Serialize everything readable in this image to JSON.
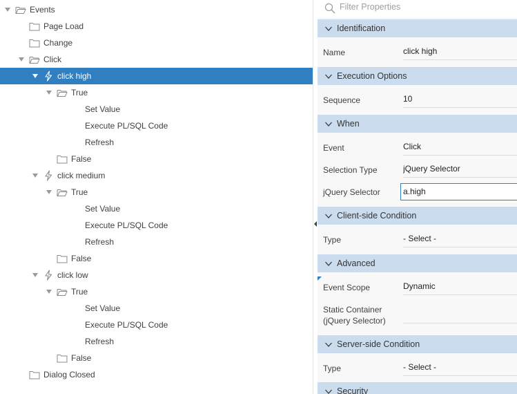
{
  "tree": {
    "events": "Events",
    "page_load": "Page Load",
    "change": "Change",
    "click": "Click",
    "click_high": "click high",
    "true_1": "True",
    "set_value_1": "Set Value",
    "exec_plsql_1": "Execute PL/SQL Code",
    "refresh_1": "Refresh",
    "false_1": "False",
    "click_medium": "click medium",
    "true_2": "True",
    "set_value_2": "Set Value",
    "exec_plsql_2": "Execute PL/SQL Code",
    "refresh_2": "Refresh",
    "false_2": "False",
    "click_low": "click low",
    "true_3": "True",
    "set_value_3": "Set Value",
    "exec_plsql_3": "Execute PL/SQL Code",
    "refresh_3": "Refresh",
    "false_3": "False",
    "dialog_closed": "Dialog Closed"
  },
  "props": {
    "filter_placeholder": "Filter Properties",
    "identification": {
      "title": "Identification",
      "name_label": "Name",
      "name_value": "click high"
    },
    "execution": {
      "title": "Execution Options",
      "sequence_label": "Sequence",
      "sequence_value": "10"
    },
    "when": {
      "title": "When",
      "event_label": "Event",
      "event_value": "Click",
      "selection_type_label": "Selection Type",
      "selection_type_value": "jQuery Selector",
      "jquery_selector_label": "jQuery Selector",
      "jquery_selector_value": "a.high"
    },
    "client_condition": {
      "title": "Client-side Condition",
      "type_label": "Type",
      "type_value": "- Select -"
    },
    "advanced": {
      "title": "Advanced",
      "event_scope_label": "Event Scope",
      "event_scope_value": "Dynamic",
      "static_container_label_1": "Static Container",
      "static_container_label_2": "(jQuery Selector)",
      "static_container_value": ""
    },
    "server_condition": {
      "title": "Server-side Condition",
      "type_label": "Type",
      "type_value": "- Select -"
    },
    "security": {
      "title": "Security"
    }
  },
  "colors": {
    "selection": "#2f7fc1",
    "group_header": "#cbdcee",
    "panel_bg": "#f8f8f8"
  },
  "icons": [
    "folder-open-icon",
    "folder-icon",
    "lightning-icon",
    "search-icon",
    "chevron-down-icon"
  ]
}
